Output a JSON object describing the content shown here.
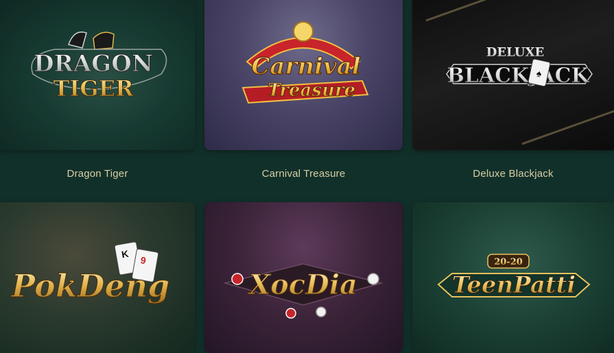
{
  "games": [
    {
      "id": "dragon-tiger",
      "title": "Dragon Tiger",
      "logo_line1": "DRAGON",
      "logo_line2": "TIGER"
    },
    {
      "id": "carnival-treasure",
      "title": "Carnival Treasure",
      "logo_line1": "Carnival",
      "logo_line2": "Treasure"
    },
    {
      "id": "deluxe-blackjack",
      "title": "Deluxe Blackjack",
      "logo_line1": "DELUXE",
      "logo_line2": "BLACKJACK"
    },
    {
      "id": "pok-deng",
      "title": "",
      "logo_line1": "PokDeng",
      "card_rank1": "K",
      "card_rank2": "9"
    },
    {
      "id": "xoc-dia",
      "title": "",
      "logo_line1": "XocDia"
    },
    {
      "id": "teen-patti",
      "title": "",
      "logo_line1": "TeenPatti",
      "logo_badge": "20-20"
    }
  ],
  "colors": {
    "page_bg": "#12302a",
    "label": "#d6cfa4",
    "gold": "#e8c56a",
    "red": "#c8242b"
  }
}
